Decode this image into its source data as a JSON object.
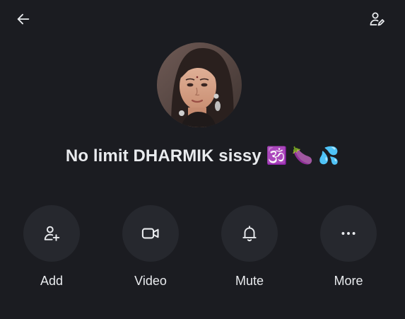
{
  "header": {
    "back_icon": "arrow-left-icon",
    "profile_icon": "person-edit-icon"
  },
  "profile": {
    "avatar_icon": "avatar",
    "name": "No limit DHARMIK sissy 🕉️ 🍆 💦"
  },
  "actions": [
    {
      "label": "Add",
      "icon": "add-person-icon"
    },
    {
      "label": "Video",
      "icon": "video-camera-icon"
    },
    {
      "label": "Mute",
      "icon": "bell-icon"
    },
    {
      "label": "More",
      "icon": "more-dots-icon"
    }
  ],
  "colors": {
    "background": "#1b1c21",
    "button_circle": "#26282e",
    "text": "#e9ebee"
  }
}
